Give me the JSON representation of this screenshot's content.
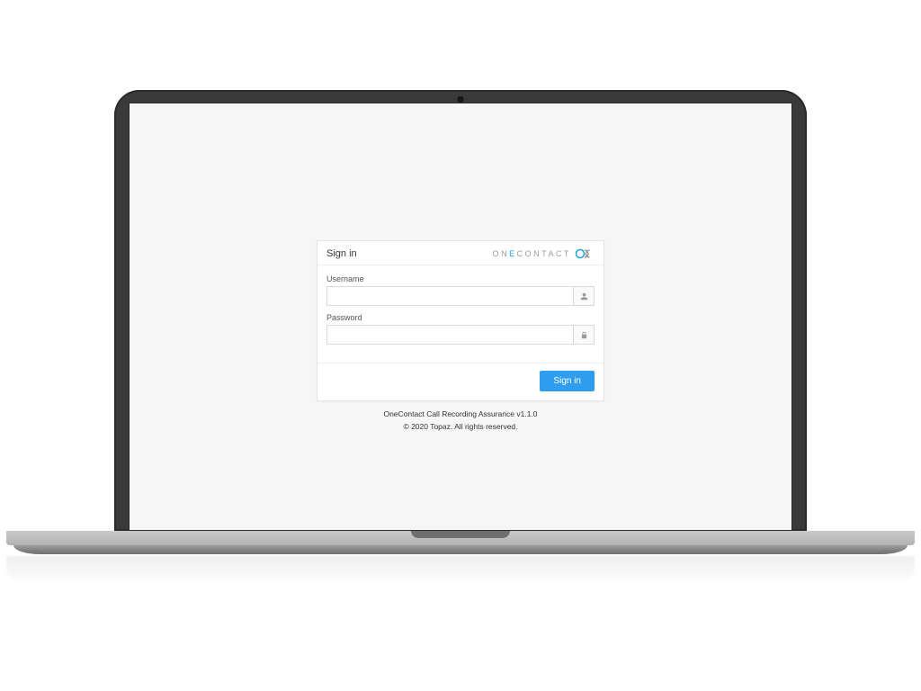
{
  "login": {
    "title": "Sign in",
    "brand_text_prefix": "ON",
    "brand_text_accent": "E",
    "brand_text_suffix": "CONTACT",
    "username_label": "Username",
    "username_value": "",
    "password_label": "Password",
    "password_value": "",
    "submit_label": "Sign in"
  },
  "footer": {
    "product": "OneContact Call Recording Assurance v1.1.0",
    "copyright": "© 2020 Topaz. All rights reserved."
  },
  "colors": {
    "accent": "#2e9df0",
    "brand_accent": "#1ba3e0"
  }
}
